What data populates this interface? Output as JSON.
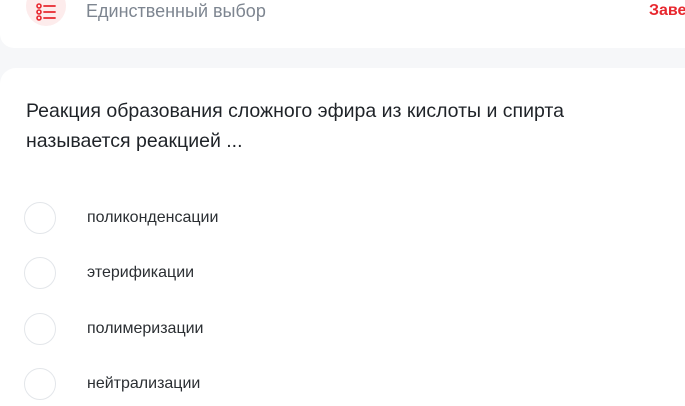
{
  "header": {
    "type_icon": "list-bullets-icon",
    "type_label": "Единственный выбор",
    "action_label": "Завершить"
  },
  "question": {
    "text": "Реакция образования сложного эфира из кислоты и спирта\nназывается реакцией ..."
  },
  "options": [
    {
      "label": "поликонденсации"
    },
    {
      "label": "этерификации"
    },
    {
      "label": "полимеризации"
    },
    {
      "label": "нейтрализации"
    }
  ],
  "colors": {
    "accent": "#e8282f",
    "icon_bg": "#fdecec",
    "muted_text": "#7d8590"
  }
}
